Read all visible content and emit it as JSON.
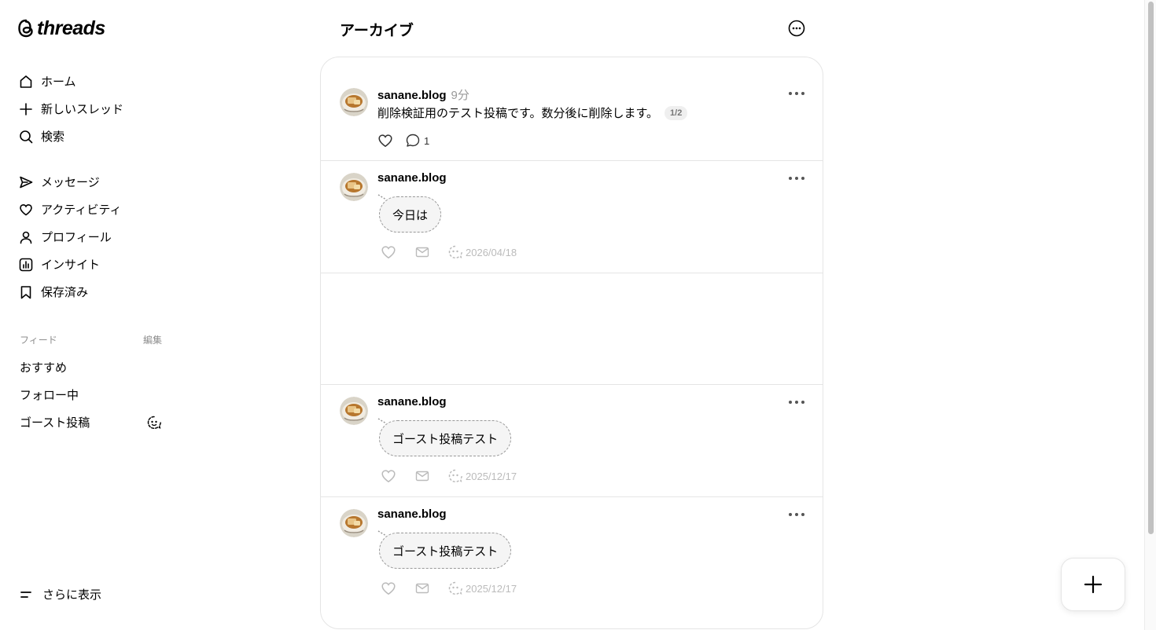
{
  "app": {
    "logo_text": "threads"
  },
  "nav": {
    "items": [
      {
        "label": "ホーム",
        "icon": "home-icon"
      },
      {
        "label": "新しいスレッド",
        "icon": "plus-icon"
      },
      {
        "label": "検索",
        "icon": "search-icon"
      },
      {
        "label": "メッセージ",
        "icon": "send-icon"
      },
      {
        "label": "アクティビティ",
        "icon": "heart-icon"
      },
      {
        "label": "プロフィール",
        "icon": "person-icon"
      },
      {
        "label": "インサイト",
        "icon": "insights-icon"
      },
      {
        "label": "保存済み",
        "icon": "bookmark-icon"
      }
    ]
  },
  "feeds": {
    "heading": "フィード",
    "edit_label": "編集",
    "items": [
      {
        "label": "おすすめ"
      },
      {
        "label": "フォロー中"
      },
      {
        "label": "ゴースト投稿",
        "icon": "ghost-icon"
      }
    ]
  },
  "more": {
    "label": "さらに表示",
    "icon": "menu-icon"
  },
  "page": {
    "title": "アーカイブ",
    "menu_icon": "more-circle-icon"
  },
  "posts": [
    {
      "username": "sanane.blog",
      "time": "9分",
      "text": "削除検証用のテスト投稿です。数分後に削除します。",
      "page_badge": "1/2",
      "reply_count": "1"
    },
    {
      "username": "sanane.blog",
      "text": "今日は",
      "date": "2026/04/18"
    },
    {
      "username": "sanane.blog",
      "text": "ゴースト投稿テスト",
      "date": "2025/12/17"
    },
    {
      "username": "sanane.blog",
      "text": "ゴースト投稿テスト",
      "date": "2025/12/17"
    }
  ],
  "fab": {
    "icon": "plus-icon"
  },
  "colors": {
    "separator": "#e5e5e5",
    "muted": "#999999",
    "ghost_border": "#999999"
  }
}
